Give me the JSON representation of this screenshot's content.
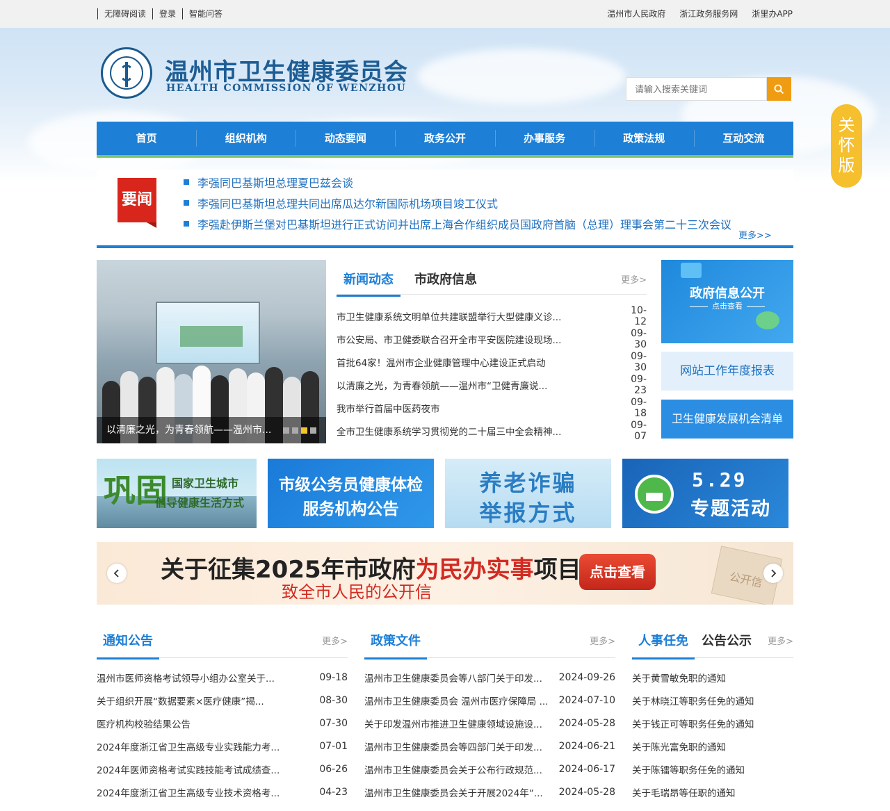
{
  "topbar": {
    "left_links": [
      "无障碍阅读",
      "登录",
      "智能问答"
    ],
    "right_links": [
      "温州市人民政府",
      "浙江政务服务网",
      "浙里办APP"
    ]
  },
  "header": {
    "title": "温州市卫生健康委员会",
    "subtitle": "HEALTH COMMISSION OF WENZHOU",
    "search_placeholder": "请输入搜索关键词",
    "care_mode": [
      "关",
      "怀",
      "版"
    ]
  },
  "nav": [
    "首页",
    "组织机构",
    "动态要闻",
    "政务公开",
    "办事服务",
    "政策法规",
    "互动交流"
  ],
  "headlines": {
    "badge": "要闻",
    "items": [
      "李强同巴基斯坦总理夏巴兹会谈",
      "李强同巴基斯坦总理共同出席瓜达尔新国际机场项目竣工仪式",
      "李强赴伊斯兰堡对巴基斯坦进行正式访问并出席上海合作组织成员国政府首脑（总理）理事会第二十三次会议"
    ],
    "more": "更多>>"
  },
  "photo": {
    "caption": "以清廉之光，为青春领航——温州市...",
    "slide_count": 4,
    "active_slide": 3
  },
  "news": {
    "tabs": [
      "新闻动态",
      "市政府信息"
    ],
    "more": "更多>",
    "items": [
      {
        "title": "市卫生健康系统文明单位共建联盟举行大型健康义诊...",
        "date": "10-12"
      },
      {
        "title": "市公安局、市卫健委联合召开全市平安医院建设现场...",
        "date": "09-30"
      },
      {
        "title": "首批64家！温州市企业健康管理中心建设正式启动",
        "date": "09-30"
      },
      {
        "title": "以清廉之光，为青春领航——温州市“卫健青廉说...",
        "date": "09-23"
      },
      {
        "title": "我市举行首届中医药夜市",
        "date": "09-18"
      },
      {
        "title": "全市卫生健康系统学习贯彻党的二十届三中全会精神...",
        "date": "09-07"
      }
    ]
  },
  "side_panels": {
    "gov_info": "政府信息公开",
    "gov_info_sub": "点击查看",
    "annual_report": "网站工作年度报表",
    "opportunity": "卫生健康发展机会清单"
  },
  "promos": {
    "p1_big": "巩固",
    "p1_l1": "国家卫生城市",
    "p1_l2": "倡导健康生活方式",
    "p2_l1": "市级公务员健康体检",
    "p2_l2": "服务机构公告",
    "p3_l1": "养老诈骗",
    "p3_l2": "举报方式",
    "p4_l1": "5.29",
    "p4_l2": "专题活动"
  },
  "wide_banner": {
    "l1_a": "关于征集2025年市政府",
    "l1_b": "为民办实事",
    "l1_c": "项目",
    "l2": "致全市人民的公开信",
    "cta": "点击查看",
    "envelope": "公开信"
  },
  "columns": {
    "notices": {
      "title": "通知公告",
      "more": "更多>",
      "items": [
        {
          "title": "温州市医师资格考试领导小组办公室关于...",
          "date": "09-18"
        },
        {
          "title": "关于组织开展“数据要素×医疗健康”揭...",
          "date": "08-30"
        },
        {
          "title": "医疗机构校验结果公告",
          "date": "07-30"
        },
        {
          "title": "2024年度浙江省卫生高级专业实践能力考...",
          "date": "07-01"
        },
        {
          "title": "2024年医师资格考试实践技能考试成绩查...",
          "date": "06-26"
        },
        {
          "title": "2024年度浙江省卫生高级专业技术资格考...",
          "date": "04-23"
        }
      ]
    },
    "policy": {
      "title": "政策文件",
      "more": "更多>",
      "items": [
        {
          "title": "温州市卫生健康委员会等八部门关于印发...",
          "date": "2024-09-26"
        },
        {
          "title": "温州市卫生健康委员会 温州市医疗保障局 ...",
          "date": "2024-07-10"
        },
        {
          "title": "关于印发温州市推进卫生健康领域设施设...",
          "date": "2024-05-28"
        },
        {
          "title": "温州市卫生健康委员会等四部门关于印发...",
          "date": "2024-06-21"
        },
        {
          "title": "温州市卫生健康委员会关于公布行政规范...",
          "date": "2024-06-17"
        },
        {
          "title": "温州市卫生健康委员会关于开展2024年“...",
          "date": "2024-05-28"
        }
      ]
    },
    "personnel": {
      "title": "人事任免",
      "title2": "公告公示",
      "more": "更多>",
      "items": [
        "关于黄雪敏免职的通知",
        "关于林晓江等职务任免的通知",
        "关于钱正可等职务任免的通知",
        "关于陈光富免职的通知",
        "关于陈镭等职务任免的通知",
        "关于毛瑞昂等任职的通知"
      ]
    }
  },
  "colors": {
    "brand_blue": "#1d7fd6",
    "accent_orange": "#f09c12",
    "care_yellow": "#f5bf2d",
    "headline_red": "#d9261c",
    "nav_green": "#7cc46a"
  }
}
